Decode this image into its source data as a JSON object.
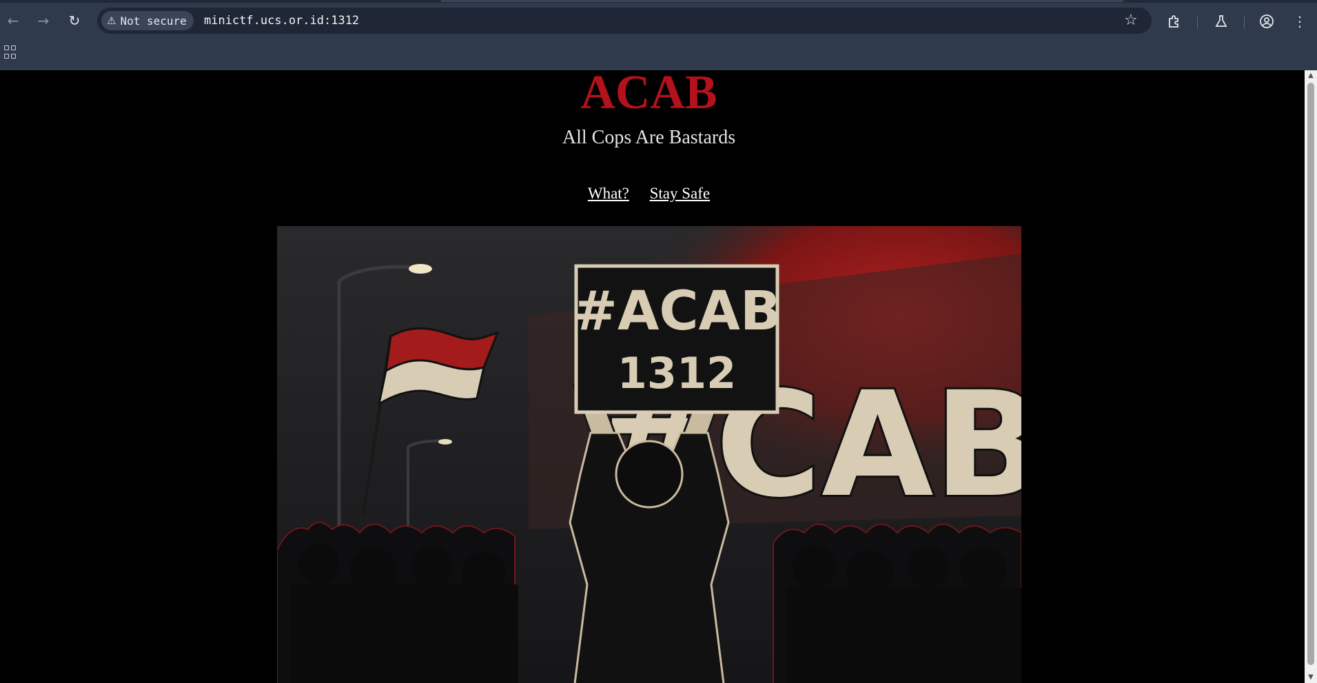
{
  "browser": {
    "security_label": "Not secure",
    "url": "minictf.ucs.or.id:1312",
    "icons": {
      "back": "arrow-left-icon",
      "forward": "arrow-right-icon",
      "reload": "reload-icon",
      "warning": "warning-triangle-icon",
      "bookmark": "star-icon",
      "extensions": "puzzle-icon",
      "labs": "flask-icon",
      "profile": "account-circle-icon",
      "menu": "kebab-menu-icon",
      "apps": "apps-grid-icon"
    }
  },
  "page": {
    "title": "ACAB",
    "subtitle": "All Cops Are Bastards",
    "nav": [
      {
        "label": "What?"
      },
      {
        "label": "Stay Safe"
      }
    ],
    "hero": {
      "sign_line1": "#ACAB",
      "sign_line2": "1312",
      "graffiti": "#CAB"
    }
  },
  "colors": {
    "title": "#b3121c",
    "background": "#000000",
    "toolbar": "#2f3a4d"
  }
}
